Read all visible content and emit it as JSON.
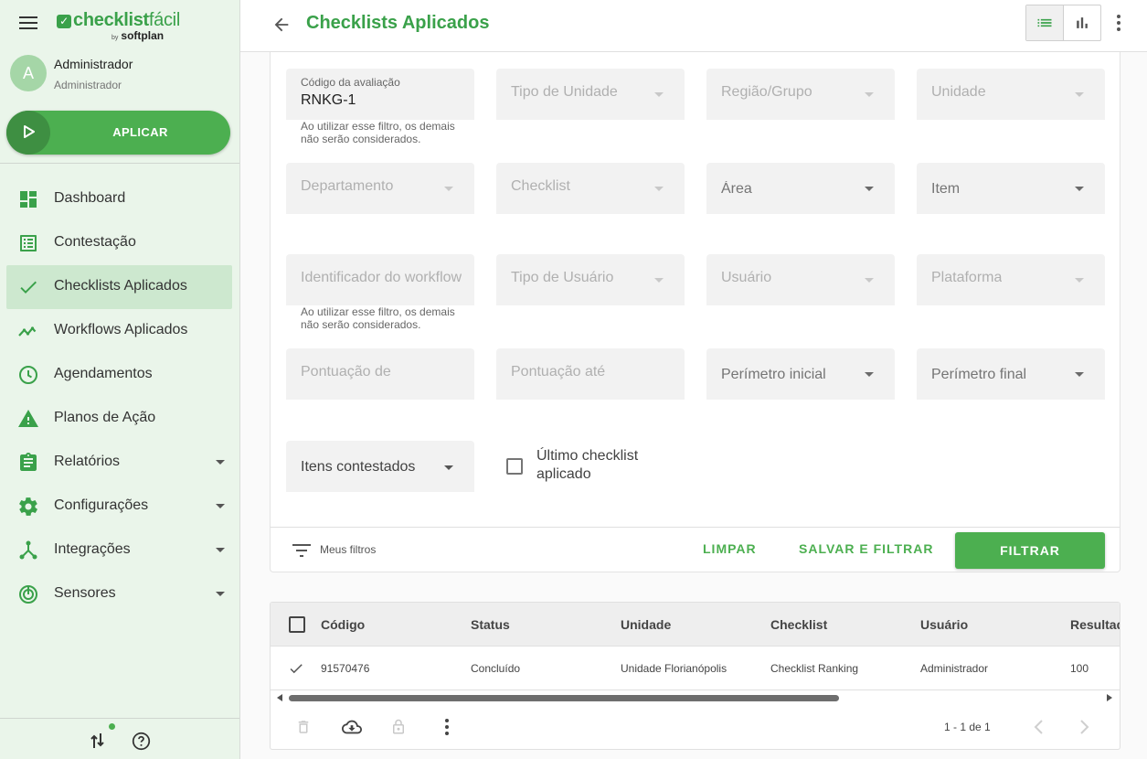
{
  "app": {
    "brand_bold": "checklist",
    "brand_light": "fácil",
    "by": "by",
    "vendor": "softplan"
  },
  "user": {
    "initial": "A",
    "name": "Administrador",
    "role": "Administrador"
  },
  "apply_button": "APLICAR",
  "nav": [
    {
      "label": "Dashboard",
      "icon": "dashboard-icon"
    },
    {
      "label": "Contestação",
      "icon": "list-alt-icon"
    },
    {
      "label": "Checklists Aplicados",
      "icon": "check-icon",
      "active": true
    },
    {
      "label": "Workflows Aplicados",
      "icon": "trending-icon"
    },
    {
      "label": "Agendamentos",
      "icon": "clock-icon"
    },
    {
      "label": "Planos de Ação",
      "icon": "warning-icon"
    },
    {
      "label": "Relatórios",
      "icon": "clipboard-icon",
      "expandable": true
    },
    {
      "label": "Configurações",
      "icon": "gear-icon",
      "expandable": true
    },
    {
      "label": "Integrações",
      "icon": "hub-icon",
      "expandable": true
    },
    {
      "label": "Sensores",
      "icon": "sensor-icon",
      "expandable": true
    }
  ],
  "header": {
    "title": "Checklists Aplicados"
  },
  "filters": {
    "codigo": {
      "label": "Código da avaliação",
      "value": "RNKG-1"
    },
    "hint": "Ao utilizar esse filtro, os demais não serão considerados.",
    "tipo_unidade": "Tipo de Unidade",
    "regiao": "Região/Grupo",
    "unidade": "Unidade",
    "departamento": "Departamento",
    "checklist": "Checklist",
    "area": "Área",
    "item": "Item",
    "workflow": "Identificador do workflow",
    "tipo_usuario": "Tipo de Usuário",
    "usuario": "Usuário",
    "plataforma": "Plataforma",
    "pontuacao_de": "Pontuação de",
    "pontuacao_ate": "Pontuação até",
    "perimetro_inicial": "Perímetro inicial",
    "perimetro_final": "Perímetro final",
    "itens_contestados": "Itens contestados",
    "ultimo_checklist": "Último checklist aplicado"
  },
  "filter_actions": {
    "my_filters": "Meus filtros",
    "clear": "LIMPAR",
    "save_filter": "SALVAR E FILTRAR",
    "filter": "FILTRAR"
  },
  "table": {
    "columns": [
      "Código",
      "Status",
      "Unidade",
      "Checklist",
      "Usuário",
      "Resultado"
    ],
    "rows": [
      {
        "codigo": "91570476",
        "status": "Concluído",
        "unidade": "Unidade Florianópolis",
        "checklist": "Checklist Ranking",
        "usuario": "Administrador",
        "resultado": "100"
      }
    ],
    "pagination": "1 - 1 de 1"
  },
  "colors": {
    "brand": "#3aa14a",
    "button": "#4caf50",
    "sidebar_bg": "#eaf5ea"
  }
}
